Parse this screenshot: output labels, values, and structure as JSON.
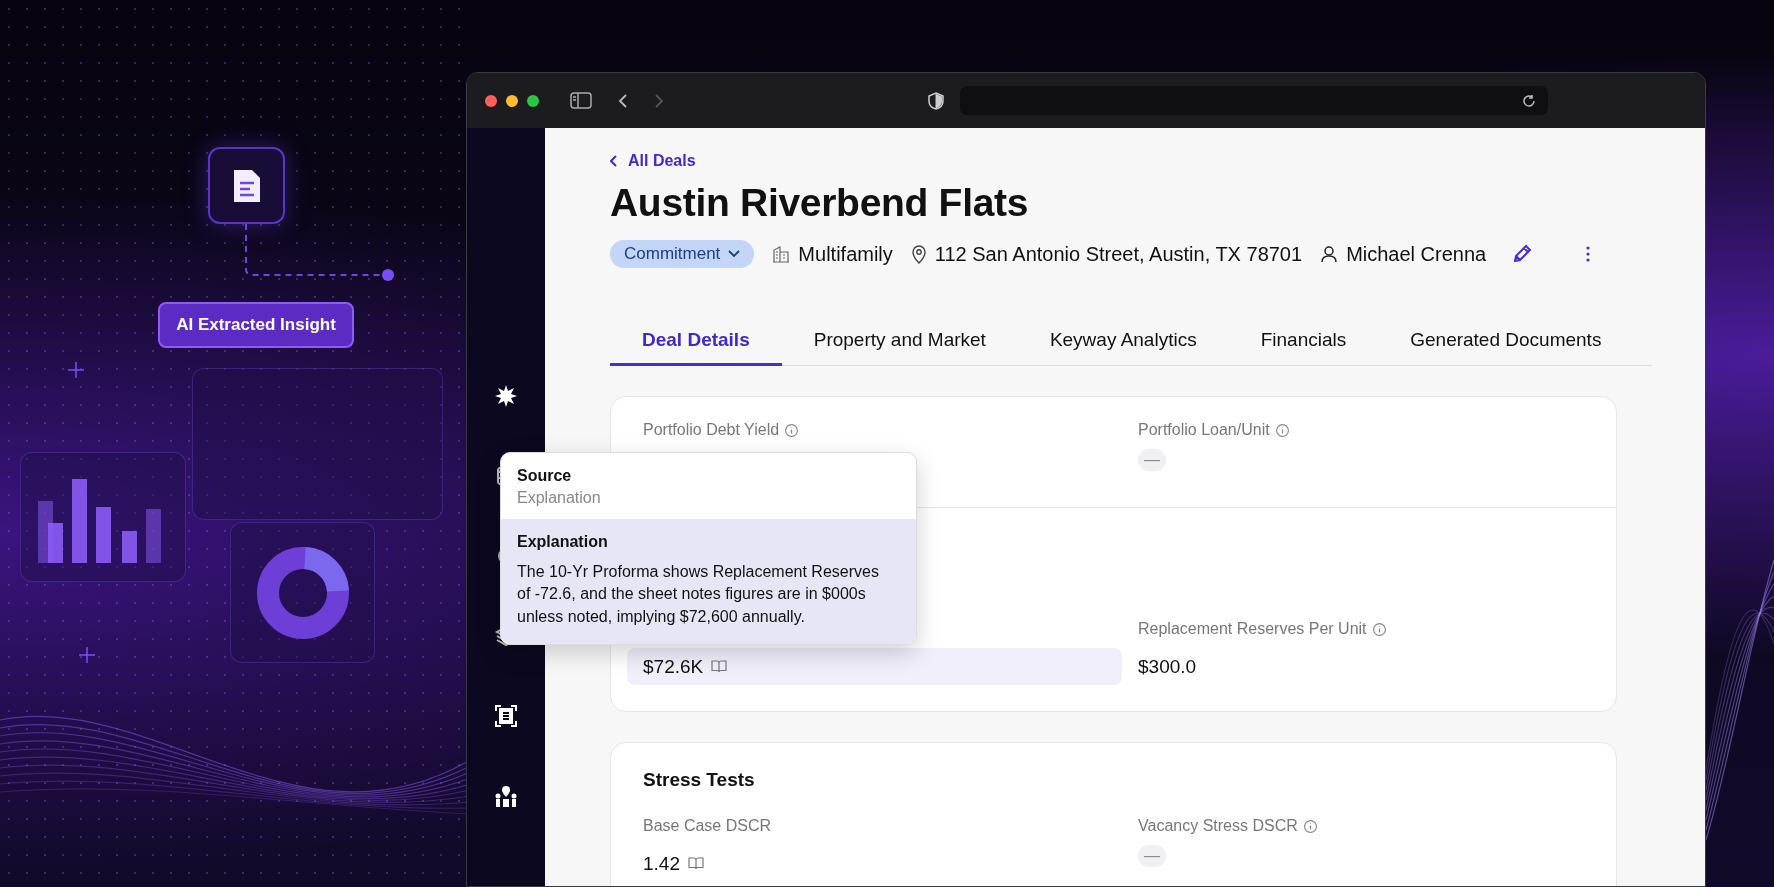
{
  "decor": {
    "badge": "AI Extracted Insight"
  },
  "back_link": "All Deals",
  "title": "Austin Riverbend Flats",
  "status": "Commitment",
  "meta": [
    {
      "kind": "building",
      "text": "Multifamily"
    },
    {
      "kind": "pin",
      "text": "112 San Antonio Street, Austin, TX 78701"
    },
    {
      "kind": "person",
      "text": "Michael Crenna"
    }
  ],
  "tabs": [
    {
      "label": "Deal Details",
      "selected": true
    },
    {
      "label": "Property and Market",
      "selected": false
    },
    {
      "label": "Keyway Analytics",
      "selected": false
    },
    {
      "label": "Financials",
      "selected": false
    },
    {
      "label": "Generated Documents",
      "selected": false
    }
  ],
  "cards": [
    {
      "groups": [
        {
          "fields": [
            {
              "label": "Portfolio Debt Yield",
              "info": true
            },
            {
              "label": "Portfolio Loan/Unit",
              "info": true,
              "kind": "dash",
              "value": "—"
            }
          ]
        },
        {
          "fields": [
            {
              "kind": "value",
              "value": "$72.6K",
              "source": true,
              "highlighted": true
            },
            {
              "label": "Replacement Reserves Per Unit",
              "info": true,
              "kind": "value",
              "value": "$300.0",
              "source": false,
              "highlighted": false
            }
          ]
        }
      ]
    },
    {
      "title": "Stress Tests",
      "groups": [
        {
          "fields": [
            {
              "label": "Base Case DSCR",
              "info": false,
              "kind": "value",
              "value": "1.42",
              "source": true,
              "highlighted": false
            },
            {
              "label": "Vacancy Stress DSCR",
              "info": true,
              "kind": "dash",
              "value": "—"
            }
          ]
        }
      ]
    }
  ],
  "tooltip": {
    "heading": "Source",
    "subheading": "Explanation",
    "section_title": "Explanation",
    "body": "The 10-Yr Proforma shows Replacement Reserves of -72.6, and the sheet notes figures are in $000s unless noted, implying $72,600 annually."
  }
}
